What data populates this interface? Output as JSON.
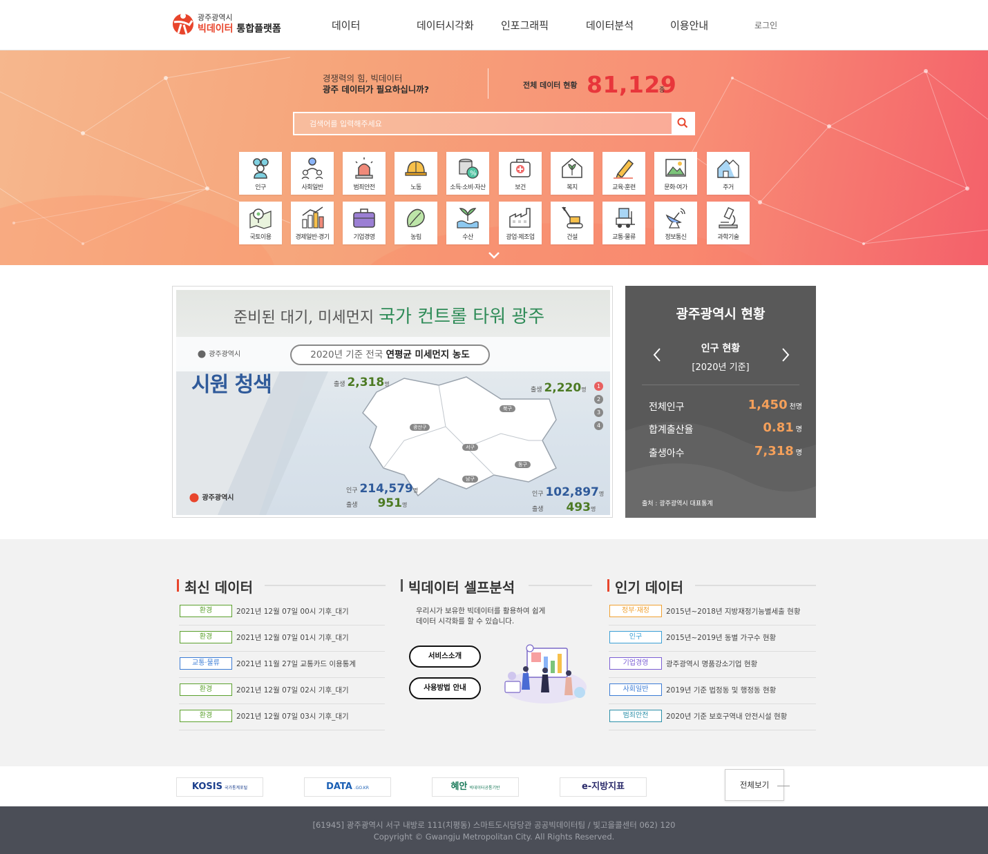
{
  "header": {
    "logo_sub": "광주광역시",
    "logo_highlight": "빅데이터",
    "logo_main": "통합플랫폼",
    "nav": [
      "데이터",
      "데이터시각화",
      "인포그래픽",
      "데이터분석",
      "이용안내"
    ],
    "login": "로그인"
  },
  "hero": {
    "intro_line1": "경쟁력의 힘, 빅데이터",
    "intro_line2": "광주 데이터가 필요하십니까?",
    "count_label": "전체 데이터 현황",
    "count_value": "81,129",
    "count_unit": "종",
    "search_placeholder": "검색어를 입력해주세요",
    "categories_row1": [
      "인구",
      "사회일반",
      "범죄안전",
      "노동",
      "소득·소비·자산",
      "보건",
      "복지",
      "교육·훈련",
      "문화·여가",
      "주거"
    ],
    "categories_row2": [
      "국토이용",
      "경제일반·경기",
      "기업경영",
      "농림",
      "수산",
      "광업·제조업",
      "건설",
      "교통·물류",
      "정보통신",
      "과학기술"
    ]
  },
  "banner": {
    "title_plain": "준비된 대기, 미세먼지 ",
    "title_green": "국가 컨트롤 타워 광주",
    "city": "광주광역시",
    "pill_plain": "2020년 기준 전국 ",
    "pill_bold": "연평균 미세먼지 농도",
    "big_text": "시원 청색",
    "stat_tl_label": "출생",
    "stat_tl_value": "2,318",
    "stat_tr_label": "출생",
    "stat_tr_value": "2,220",
    "stat_bl_pop_label": "인구",
    "stat_bl_pop_value": "214,579",
    "stat_bl_birth_label": "출생",
    "stat_bl_birth_value": "951",
    "stat_br_pop_label": "인구",
    "stat_br_pop_value": "102,897",
    "stat_br_birth_label": "출생",
    "stat_br_birth_value": "493",
    "unit": "명",
    "districts": [
      "북구",
      "광산구",
      "서구",
      "동구",
      "남구"
    ],
    "pages": [
      "1",
      "2",
      "3",
      "4"
    ],
    "bottom_logo": "광주광역시"
  },
  "status": {
    "title": "광주광역시 현황",
    "subtitle": "인구 현황",
    "year": "[2020년 기준]",
    "rows": [
      {
        "label": "전체인구",
        "value": "1,450",
        "unit": "천명"
      },
      {
        "label": "합계출산율",
        "value": "0.81",
        "unit": "명"
      },
      {
        "label": "출생아수",
        "value": "7,318",
        "unit": "명"
      }
    ],
    "source": "출처 : 광주광역시 대표통계"
  },
  "latest": {
    "title": "최신 데이터",
    "items": [
      {
        "tag": "환경",
        "text": "2021년 12월 07일 00시 기후_대기"
      },
      {
        "tag": "환경",
        "text": "2021년 12월 07일 01시 기후_대기"
      },
      {
        "tag": "교통·물류",
        "text": "2021년 11월 27일 교통카드 이용통계"
      },
      {
        "tag": "환경",
        "text": "2021년 12월 07일 02시 기후_대기"
      },
      {
        "tag": "환경",
        "text": "2021년 12월 07일 03시 기후_대기"
      }
    ]
  },
  "self": {
    "title": "빅데이터 셀프분석",
    "desc1": "우리시가 보유한 빅데이터를 활용하여 쉽게",
    "desc2": "데이터 시각화를 할 수 있습니다.",
    "btn1": "서비스소개",
    "btn2": "사용방법 안내"
  },
  "popular": {
    "title": "인기 데이터",
    "items": [
      {
        "tag": "정부·재정",
        "text": "2015년~2018년 지방재정기능별세출 현황"
      },
      {
        "tag": "인구",
        "text": "2015년~2019년 동별 가구수 현황"
      },
      {
        "tag": "기업경영",
        "text": "광주광역시 명품강소기업 현황"
      },
      {
        "tag": "사회일반",
        "text": "2019년 기준 법정동 및 행정동 현황"
      },
      {
        "tag": "범죄안전",
        "text": "2020년 기준 보호구역내 안전시설 현황"
      }
    ]
  },
  "partners": {
    "logos": [
      "KOSIS",
      "DATA",
      "혜안",
      "e-지방지표"
    ],
    "logo_subs": [
      "국가통계포털",
      ".GO.KR",
      "빅데이터공통기반",
      ""
    ],
    "view_all": "전체보기"
  },
  "footer": {
    "address": "[61945] 광주광역시 서구 내방로 111(치평동) 스마트도시담당관 공공빅데이터팀 / 빛고을콜센터 062) 120",
    "copyright": "Copyright © Gwangju Metropolitan City. All Rights Reserved."
  },
  "colors": {
    "brand": "#e8452c",
    "count": "#e8363b",
    "status_value": "#f5a05a",
    "tag_env": "#5aa02c",
    "tag_blue": "#3a7bd5",
    "tag_orange": "#f0a030",
    "tag_purple": "#7b5ed4",
    "tag_teal": "#2a8fa8"
  }
}
